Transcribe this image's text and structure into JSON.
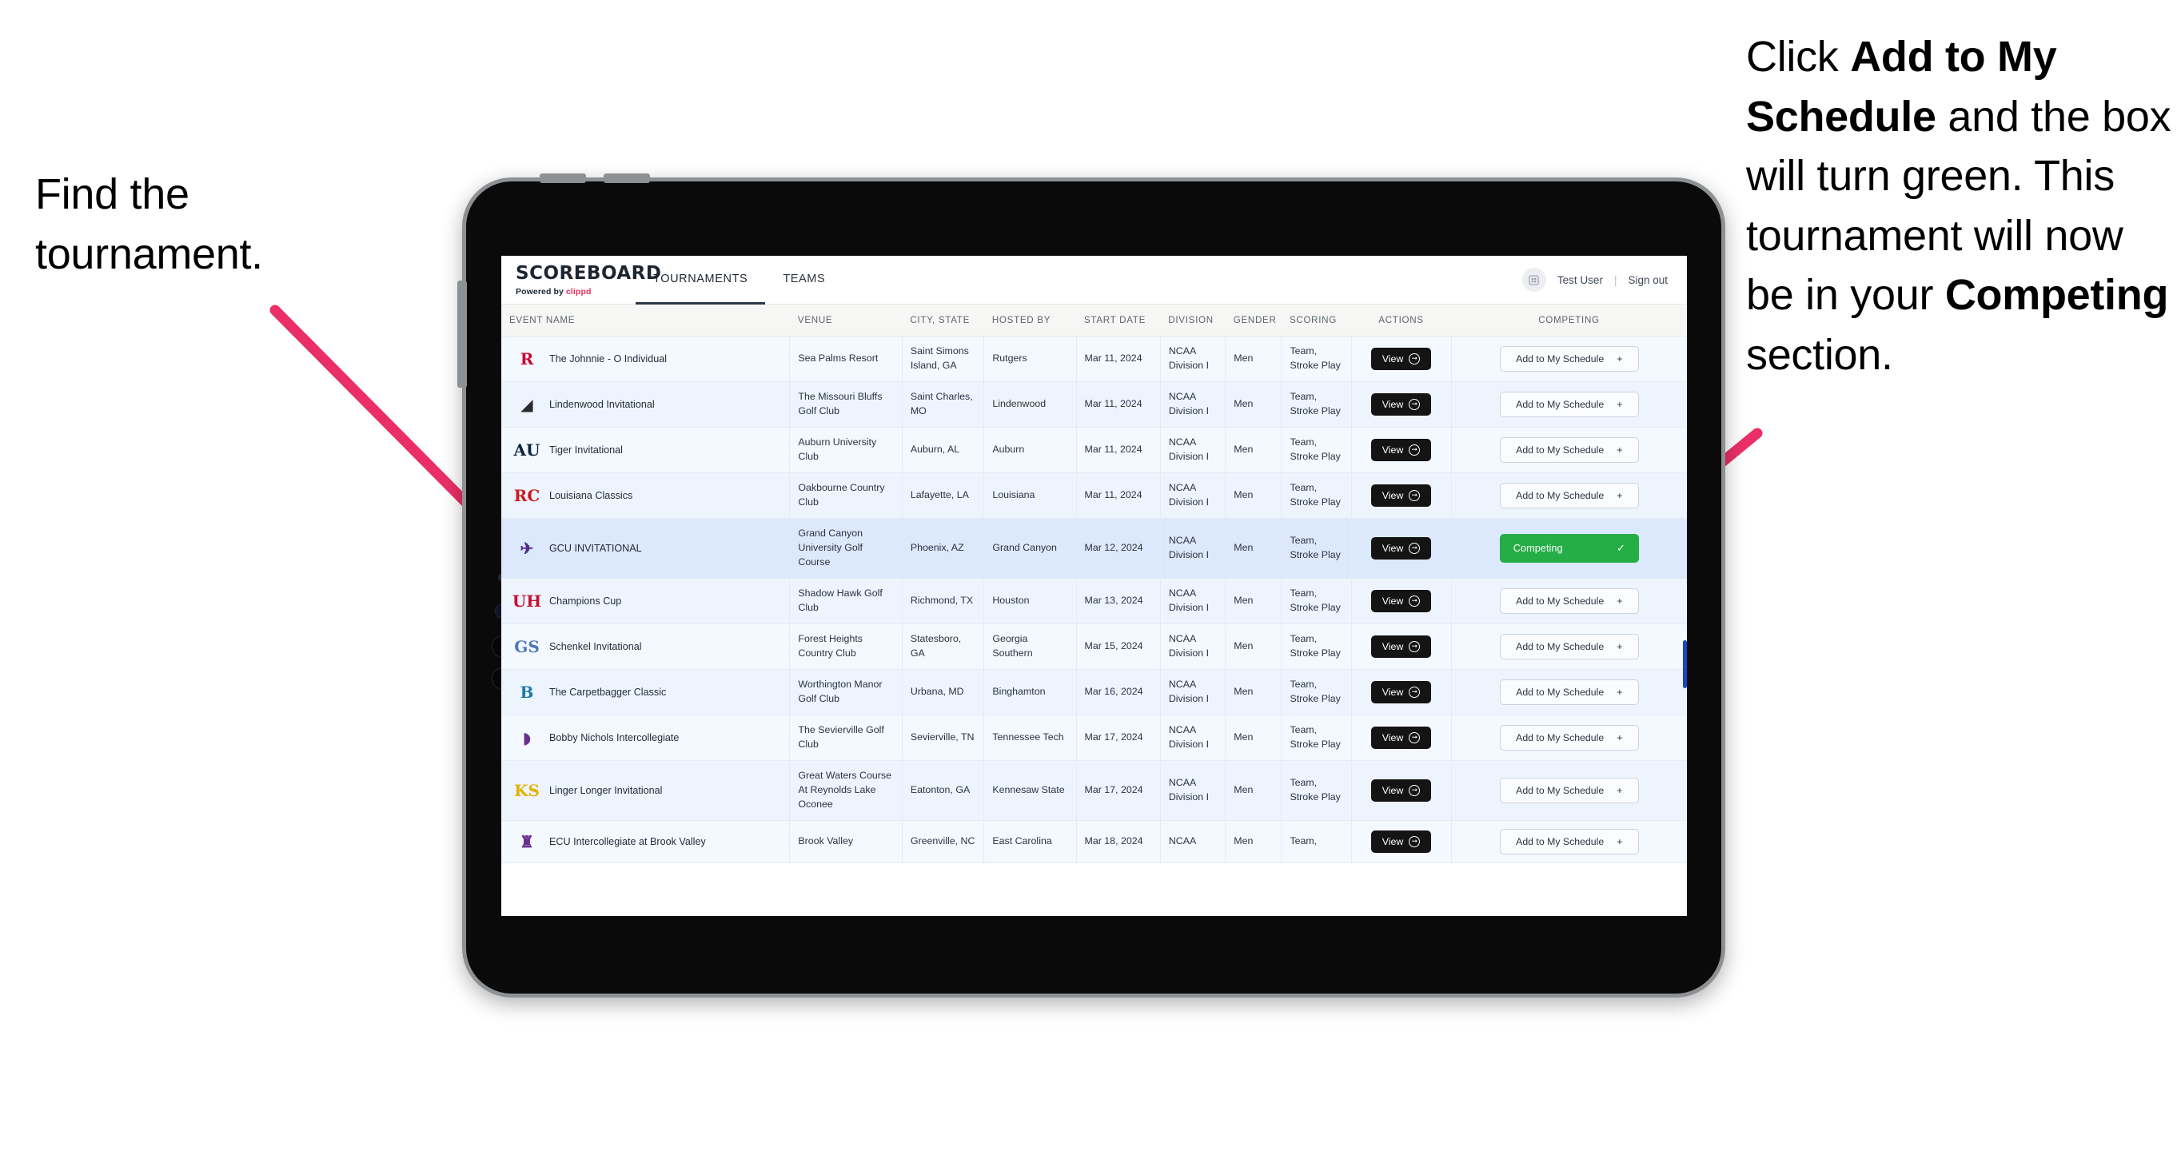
{
  "annotations": {
    "left": {
      "line1": "Find the",
      "line2": "tournament."
    },
    "right": {
      "seg1": "Click ",
      "bold1": "Add to My Schedule",
      "seg2": " and the box will turn green. This tournament will now be in your ",
      "bold2": "Competing",
      "seg3": " section."
    },
    "arrow_color": "#ea2f66"
  },
  "app": {
    "brand": {
      "title": "SCOREBOARD",
      "powered_prefix": "Powered by ",
      "powered_brand": "clippd"
    },
    "nav_tabs": [
      {
        "label": "TOURNAMENTS",
        "active": true
      },
      {
        "label": "TEAMS",
        "active": false
      }
    ],
    "header_right": {
      "avatar_icon": "user-grid-icon",
      "user_name": "Test User",
      "separator": "|",
      "sign_out": "Sign out"
    }
  },
  "table": {
    "columns": [
      {
        "key": "event",
        "label": "EVENT NAME",
        "align": "left"
      },
      {
        "key": "venue",
        "label": "VENUE",
        "align": "left"
      },
      {
        "key": "city",
        "label": "CITY, STATE",
        "align": "left"
      },
      {
        "key": "hosted",
        "label": "HOSTED BY",
        "align": "left"
      },
      {
        "key": "start",
        "label": "START DATE",
        "align": "left"
      },
      {
        "key": "division",
        "label": "DIVISION",
        "align": "left"
      },
      {
        "key": "gender",
        "label": "GENDER",
        "align": "left"
      },
      {
        "key": "scoring",
        "label": "SCORING",
        "align": "left"
      },
      {
        "key": "actions",
        "label": "ACTIONS",
        "align": "center"
      },
      {
        "key": "competing",
        "label": "COMPETING",
        "align": "center"
      }
    ],
    "buttons": {
      "view_label": "View",
      "view_icon": "arrow-right-circle-icon",
      "add_label": "Add to My Schedule",
      "add_icon": "plus-icon",
      "competing_label": "Competing",
      "competing_icon": "check-icon"
    },
    "rows": [
      {
        "logo": {
          "text": "R",
          "color": "#cc0033",
          "bg": "transparent"
        },
        "event": "The Johnnie - O Individual",
        "venue": "Sea Palms Resort",
        "city": "Saint Simons Island, GA",
        "hosted": "Rutgers",
        "start": "Mar 11, 2024",
        "division": "NCAA Division I",
        "gender": "Men",
        "scoring": "Team, Stroke Play",
        "competing": false,
        "selected": false
      },
      {
        "logo": {
          "text": "◢",
          "color": "#2b2b2b",
          "bg": "transparent"
        },
        "event": "Lindenwood Invitational",
        "venue": "The Missouri Bluffs Golf Club",
        "city": "Saint Charles, MO",
        "hosted": "Lindenwood",
        "start": "Mar 11, 2024",
        "division": "NCAA Division I",
        "gender": "Men",
        "scoring": "Team, Stroke Play",
        "competing": false,
        "selected": false
      },
      {
        "logo": {
          "text": "AU",
          "color": "#0c2340",
          "bg": "transparent"
        },
        "event": "Tiger Invitational",
        "venue": "Auburn University Club",
        "city": "Auburn, AL",
        "hosted": "Auburn",
        "start": "Mar 11, 2024",
        "division": "NCAA Division I",
        "gender": "Men",
        "scoring": "Team, Stroke Play",
        "competing": false,
        "selected": false
      },
      {
        "logo": {
          "text": "RC",
          "color": "#ce181e",
          "bg": "transparent"
        },
        "event": "Louisiana Classics",
        "venue": "Oakbourne Country Club",
        "city": "Lafayette, LA",
        "hosted": "Louisiana",
        "start": "Mar 11, 2024",
        "division": "NCAA Division I",
        "gender": "Men",
        "scoring": "Team, Stroke Play",
        "competing": false,
        "selected": false
      },
      {
        "logo": {
          "text": "✈",
          "color": "#4f2d8f",
          "bg": "transparent"
        },
        "event": "GCU INVITATIONAL",
        "venue": "Grand Canyon University Golf Course",
        "city": "Phoenix, AZ",
        "hosted": "Grand Canyon",
        "start": "Mar 12, 2024",
        "division": "NCAA Division I",
        "gender": "Men",
        "scoring": "Team, Stroke Play",
        "competing": true,
        "selected": true
      },
      {
        "logo": {
          "text": "UH",
          "color": "#c8102e",
          "bg": "transparent"
        },
        "event": "Champions Cup",
        "venue": "Shadow Hawk Golf Club",
        "city": "Richmond, TX",
        "hosted": "Houston",
        "start": "Mar 13, 2024",
        "division": "NCAA Division I",
        "gender": "Men",
        "scoring": "Team, Stroke Play",
        "competing": false,
        "selected": false
      },
      {
        "logo": {
          "text": "GS",
          "color": "#4a78b8",
          "bg": "transparent"
        },
        "event": "Schenkel Invitational",
        "venue": "Forest Heights Country Club",
        "city": "Statesboro, GA",
        "hosted": "Georgia Southern",
        "start": "Mar 15, 2024",
        "division": "NCAA Division I",
        "gender": "Men",
        "scoring": "Team, Stroke Play",
        "competing": false,
        "selected": false
      },
      {
        "logo": {
          "text": "B",
          "color": "#1c7ba8",
          "bg": "transparent"
        },
        "event": "The Carpetbagger Classic",
        "venue": "Worthington Manor Golf Club",
        "city": "Urbana, MD",
        "hosted": "Binghamton",
        "start": "Mar 16, 2024",
        "division": "NCAA Division I",
        "gender": "Men",
        "scoring": "Team, Stroke Play",
        "competing": false,
        "selected": false
      },
      {
        "logo": {
          "text": "◗",
          "color": "#6a2f8f",
          "bg": "transparent"
        },
        "event": "Bobby Nichols Intercollegiate",
        "venue": "The Sevierville Golf Club",
        "city": "Sevierville, TN",
        "hosted": "Tennessee Tech",
        "start": "Mar 17, 2024",
        "division": "NCAA Division I",
        "gender": "Men",
        "scoring": "Team, Stroke Play",
        "competing": false,
        "selected": false
      },
      {
        "logo": {
          "text": "KS",
          "color": "#e2b200",
          "bg": "transparent"
        },
        "event": "Linger Longer Invitational",
        "venue": "Great Waters Course At Reynolds Lake Oconee",
        "city": "Eatonton, GA",
        "hosted": "Kennesaw State",
        "start": "Mar 17, 2024",
        "division": "NCAA Division I",
        "gender": "Men",
        "scoring": "Team, Stroke Play",
        "competing": false,
        "selected": false
      },
      {
        "logo": {
          "text": "♜",
          "color": "#6a2f8f",
          "bg": "transparent"
        },
        "event": "ECU Intercollegiate at Brook Valley",
        "venue": "Brook Valley",
        "city": "Greenville, NC",
        "hosted": "East Carolina",
        "start": "Mar 18, 2024",
        "division": "NCAA",
        "gender": "Men",
        "scoring": "Team,",
        "competing": false,
        "selected": false
      }
    ]
  }
}
